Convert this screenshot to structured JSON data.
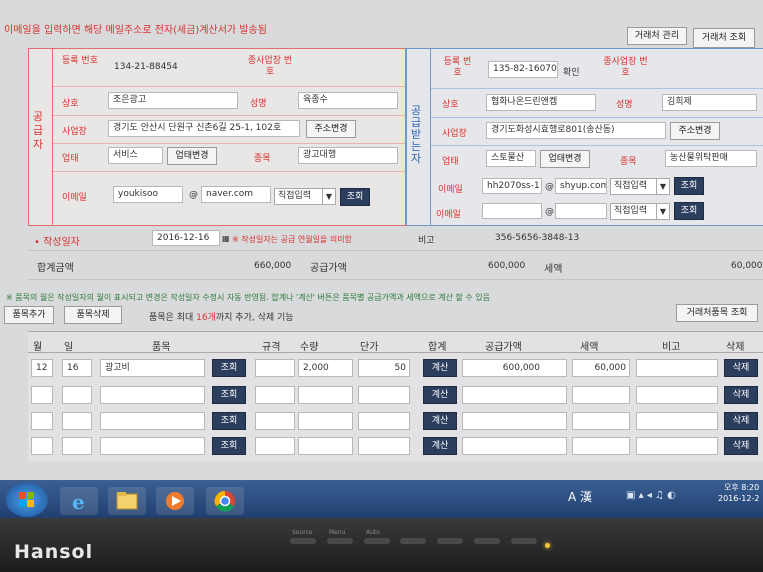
{
  "notice": "이메일을 입력하면 해당 메일주소로 전자(세금)계산서가 발송됨",
  "top_buttons": {
    "client_manage": "거래처 관리",
    "client_search": "거래처 조회"
  },
  "supplier": {
    "side_label": "공급자",
    "reg_no_label": "등록 번호",
    "reg_no": "134-21-88454",
    "sub_biz_label": "종사업장 번호",
    "company_label": "상호",
    "company": "조은광고",
    "name_label": "성명",
    "name": "육종수",
    "address_label": "사업장",
    "address": "경기도 안산시 단원구 신촌6길 25-1, 102호",
    "address_change_btn": "주소변경",
    "biz_type_label": "업태",
    "biz_type": "서비스",
    "biz_change_btn": "업태변경",
    "item_label": "종목",
    "item": "광고대행",
    "email_label": "이메일",
    "email_id": "youkisoo",
    "at": "@",
    "email_domain": "naver.com",
    "domain_select": "직접입력",
    "search_btn": "조회"
  },
  "receiver": {
    "side_label": "공급받는자",
    "reg_no_label": "등록 번호",
    "reg_no": "135-82-16070",
    "confirm_btn": "확인",
    "sub_biz_label": "종사업장 번호",
    "company_label": "상호",
    "company": "협화나온드린앤켐",
    "name_label": "성명",
    "name": "김희제",
    "address_label": "사업장",
    "address": "경기도화성시효행로801(송산동)",
    "address_change_btn": "주소변경",
    "biz_type_label": "업태",
    "biz_type": "스토물산",
    "biz_change_btn": "업태변경",
    "item_label": "종목",
    "item": "농산물위탁판매",
    "email_label": "이메일",
    "email_id": "hh2070ss-1",
    "at": "@",
    "email_domain": "shyup.com",
    "domain_select": "직접입력",
    "search_btn": "조회",
    "email2_label": "이메일",
    "email2_domain_select": "직접입력",
    "search2_btn": "조회"
  },
  "write_date": {
    "label": "작성일자",
    "value": "2016-12-16",
    "note": "※ 작성일자는 공급 연월일을 의미함",
    "remarks_label": "비고",
    "remarks_value": "356-5656-3848-13"
  },
  "totals": {
    "total_label": "합계금액",
    "total": "660,000",
    "supply_label": "공급가액",
    "supply": "600,000",
    "tax_label": "세액",
    "tax": "60,000"
  },
  "items_note": "※ 품목의 월은 작성일자의 월이 표시되고 변경은 작성일자 수정시 자동 반영됨. 합계나 '계산' 버튼은 품목별 공급가액과 세액으로 계산 할 수 있음",
  "item_controls": {
    "add_btn": "품목추가",
    "delete_btn": "품목삭제",
    "limit_text_a": "품목은 최대",
    "limit_count": "16개",
    "limit_text_b": "까지 추가, 삭제 기능",
    "client_item_btn": "거래처품목 조회"
  },
  "table": {
    "headers": [
      "월",
      "일",
      "품목",
      "규격",
      "수량",
      "단가",
      "합계",
      "공급가액",
      "세액",
      "비고",
      "삭제"
    ],
    "rows": [
      {
        "month": "12",
        "day": "16",
        "item": "광고비",
        "search": "조회",
        "qty": "2,000",
        "price": "50",
        "calc": "계산",
        "supply": "600,000",
        "tax": "60,000",
        "delete": "삭제"
      },
      {
        "month": "",
        "day": "",
        "item": "",
        "search": "조회",
        "qty": "",
        "price": "",
        "calc": "계산",
        "supply": "",
        "tax": "",
        "delete": "삭제"
      },
      {
        "month": "",
        "day": "",
        "item": "",
        "search": "조회",
        "qty": "",
        "price": "",
        "calc": "계산",
        "supply": "",
        "tax": "",
        "delete": "삭제"
      },
      {
        "month": "",
        "day": "",
        "item": "",
        "search": "조회",
        "qty": "",
        "price": "",
        "calc": "계산",
        "supply": "",
        "tax": "",
        "delete": "삭제"
      }
    ]
  },
  "taskbar": {
    "lang_indicator": "A 漢",
    "time": "오후 8:20",
    "date": "2016-12-2"
  },
  "monitor": {
    "brand": "Hansol",
    "buttons": [
      "Source",
      "Menu",
      "Auto",
      "",
      "",
      "",
      "",
      ""
    ]
  },
  "colors": {
    "supplier_accent": "#d8322f",
    "receiver_accent": "#2a66b8",
    "action_button": "#2c3e5e",
    "taskbar": "#24477a"
  }
}
